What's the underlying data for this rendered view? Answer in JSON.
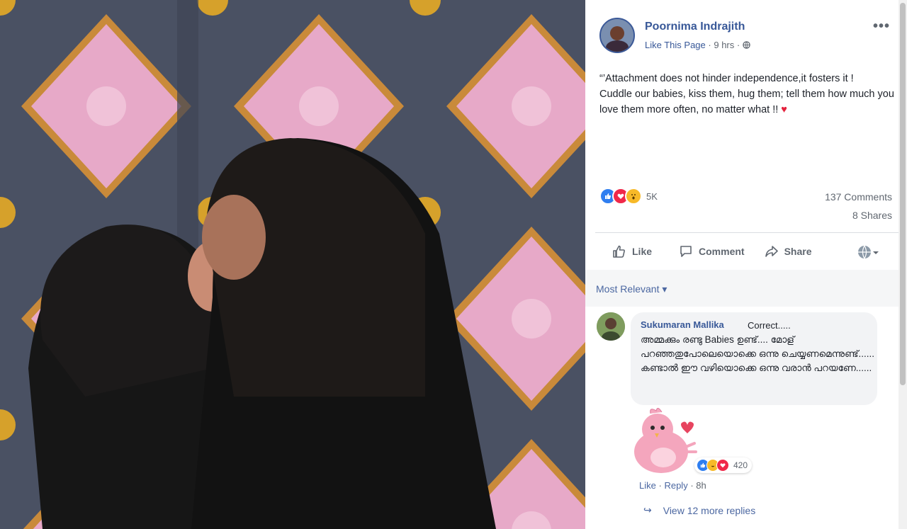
{
  "post": {
    "author": "Poornima Indrajith",
    "like_page": "Like This Page",
    "separator": "·",
    "time": "9 hrs",
    "separator2": "·",
    "more": "•••",
    "text_line1": "“’Attachment does not hinder independence,it fosters it !",
    "text_line2": "Cuddle our babies, kiss them, hug them; tell them how much you love them more often, no matter what !!",
    "text_heart": "♥"
  },
  "stats": {
    "reaction_count": "5K",
    "comments": "137 Comments",
    "shares": "8 Shares"
  },
  "actions": {
    "like": "Like",
    "comment": "Comment",
    "share": "Share"
  },
  "filter": {
    "label": "Most Relevant ▾"
  },
  "comment": {
    "author": "Sukumaran Mallika",
    "first": "Correct.....",
    "text": "അമ്മക്കും രണ്ടു Babies ഉണ്ട്.... മോള് പറഞ്ഞതുപോലെയൊക്കെ ഒന്നു ചെയ്യണമെന്നുണ്ട്...... കണ്ടാൽ ഈ വഴിയൊക്കെ ഒന്നു വരാൻ പറയണേ......",
    "reaction_count": "420",
    "like": "Like",
    "dot1": "·",
    "reply": "Reply",
    "dot2": "·",
    "time": "8h"
  },
  "replies": {
    "arrow": "↪",
    "label": "View 12 more replies"
  },
  "colors": {
    "link": "#385898",
    "muted": "#606770",
    "like_blue": "#2f7ef0",
    "love_red": "#f02849",
    "wow_yellow": "#f7b928"
  }
}
